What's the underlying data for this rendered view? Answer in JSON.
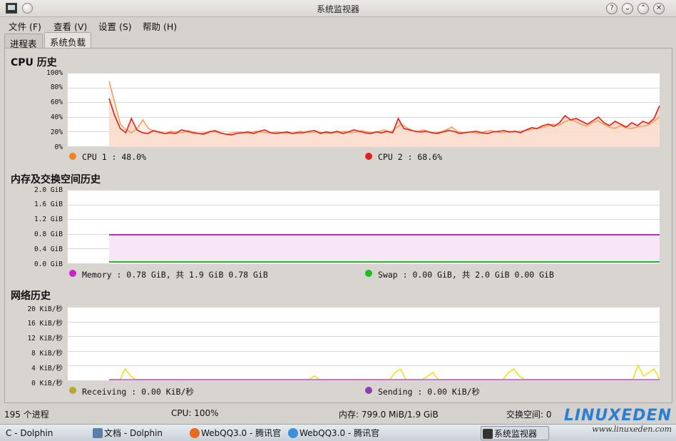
{
  "window": {
    "title": "系统监视器"
  },
  "menu": {
    "items": [
      "文件 (F)",
      "查看 (V)",
      "设置 (S)",
      "帮助 (H)"
    ]
  },
  "tabs": [
    {
      "label": "进程表",
      "active": false
    },
    {
      "label": "系统负载",
      "active": true
    }
  ],
  "sections": {
    "cpu": {
      "title": "CPU 历史",
      "ticks": [
        "100%",
        "80%",
        "60%",
        "40%",
        "20%",
        "0%"
      ],
      "legend": [
        {
          "label": "CPU 1 : 48.0%",
          "color": "#f58220"
        },
        {
          "label": "CPU 2 : 68.6%",
          "color": "#e0201c"
        }
      ]
    },
    "memory": {
      "title": "内存及交换空间历史",
      "ticks": [
        "2.0 GiB",
        "1.6 GiB",
        "1.2 GiB",
        "0.8 GiB",
        "0.4 GiB",
        "0.0 GiB"
      ],
      "legend": [
        {
          "label": "Memory : 0.78 GiB, 共 1.9 GiB 0.78 GiB",
          "color": "#cc22cc"
        },
        {
          "label": "Swap : 0.00 GiB, 共 2.0 GiB 0.00 GiB",
          "color": "#22bb22"
        }
      ]
    },
    "network": {
      "title": "网络历史",
      "ticks": [
        "20 KiB/秒",
        "16 KiB/秒",
        "12 KiB/秒",
        "8 KiB/秒",
        "4 KiB/秒",
        "0 KiB/秒"
      ],
      "legend": [
        {
          "label": "Receiving : 0.00 KiB/秒",
          "color": "#b8a830"
        },
        {
          "label": "Sending : 0.00 KiB/秒",
          "color": "#8844aa"
        }
      ]
    }
  },
  "chart_data": [
    {
      "type": "line",
      "title": "CPU 历史",
      "ylim": [
        0,
        100
      ],
      "ticks": [
        "100%",
        "80%",
        "60%",
        "40%",
        "20%",
        "0%"
      ],
      "grid": true,
      "x_count": 96,
      "series": [
        {
          "name": "CPU 1",
          "color": "#f5a060",
          "values": [
            90,
            60,
            30,
            22,
            18,
            24,
            36,
            24,
            20,
            18,
            17,
            20,
            19,
            18,
            21,
            19,
            17,
            18,
            20,
            19,
            17,
            16,
            18,
            19,
            18,
            17,
            20,
            19,
            18,
            18,
            19,
            18,
            17,
            18,
            20,
            19,
            18,
            19,
            18,
            17,
            18,
            19,
            20,
            18,
            19,
            21,
            19,
            18,
            20,
            22,
            18,
            24,
            30,
            25,
            21,
            20,
            22,
            19,
            18,
            19,
            22,
            26,
            20,
            18,
            19,
            18,
            17,
            20,
            21,
            19,
            18,
            20,
            19,
            20,
            21,
            22,
            24,
            25,
            27,
            30,
            28,
            33,
            36,
            34,
            30,
            27,
            32,
            35,
            30,
            26,
            24,
            28,
            25,
            24,
            26,
            27,
            29,
            34,
            40
          ]
        },
        {
          "name": "CPU 2",
          "color": "#e0201c",
          "values": [
            66,
            42,
            24,
            18,
            38,
            22,
            18,
            17,
            21,
            19,
            17,
            18,
            17,
            22,
            20,
            18,
            17,
            16,
            19,
            21,
            18,
            16,
            15,
            17,
            18,
            19,
            17,
            20,
            22,
            18,
            17,
            18,
            19,
            17,
            18,
            18,
            20,
            21,
            17,
            19,
            18,
            20,
            17,
            19,
            22,
            20,
            18,
            17,
            19,
            18,
            20,
            18,
            38,
            24,
            22,
            20,
            19,
            20,
            18,
            17,
            19,
            21,
            20,
            17,
            18,
            19,
            20,
            18,
            17,
            19,
            20,
            21,
            19,
            20,
            18,
            22,
            25,
            24,
            28,
            30,
            27,
            32,
            42,
            36,
            38,
            34,
            30,
            35,
            40,
            32,
            28,
            34,
            30,
            26,
            32,
            28,
            34,
            31,
            38,
            56
          ]
        }
      ]
    },
    {
      "type": "line",
      "title": "内存及交换空间历史",
      "ylim": [
        0,
        2.0
      ],
      "ticks": [
        "2.0 GiB",
        "1.6 GiB",
        "1.2 GiB",
        "0.8 GiB",
        "0.4 GiB",
        "0.0 GiB"
      ],
      "grid": true,
      "x_count": 96,
      "start_index": 7,
      "series": [
        {
          "name": "Memory",
          "color": "#cc22cc",
          "constant": 0.78
        },
        {
          "name": "Swap",
          "color": "#22bb22",
          "constant": 0.02
        }
      ]
    },
    {
      "type": "line",
      "title": "网络历史",
      "ylim": [
        0,
        20
      ],
      "ticks": [
        "20 KiB/秒",
        "16 KiB/秒",
        "12 KiB/秒",
        "8 KiB/秒",
        "4 KiB/秒",
        "0 KiB/秒"
      ],
      "grid": true,
      "x_count": 96,
      "series": [
        {
          "name": "Receiving",
          "color": "#f0e020",
          "values": [
            0,
            0,
            0,
            3,
            1,
            0,
            0,
            0,
            0,
            0,
            0,
            0,
            0,
            0,
            0,
            0,
            0,
            0,
            0,
            0,
            0,
            0,
            0,
            0,
            0,
            0,
            0,
            0,
            0,
            0,
            0,
            0,
            0,
            0,
            0,
            0,
            0,
            0,
            1,
            0,
            0,
            0,
            0,
            0,
            0,
            0,
            0,
            0,
            0,
            0,
            0,
            0,
            0,
            2,
            3,
            0,
            0,
            0,
            0,
            1,
            2,
            0,
            0,
            0,
            0,
            0,
            0,
            0,
            0,
            0,
            0,
            0,
            0,
            0,
            2,
            3,
            1,
            0,
            0,
            0,
            0,
            0,
            0,
            0,
            0,
            0,
            0,
            0,
            0,
            0,
            0,
            0,
            0,
            0,
            0,
            0,
            0,
            0,
            4,
            1,
            2,
            3,
            0
          ]
        },
        {
          "name": "Sending",
          "color": "#aa55cc",
          "values": [
            0,
            0,
            0,
            0,
            0,
            0,
            0,
            0,
            0,
            0,
            0,
            0,
            0,
            0,
            0,
            0,
            0,
            0,
            0,
            0,
            0,
            0,
            0,
            0,
            0,
            0,
            0,
            0,
            0,
            0,
            0,
            0,
            0,
            0,
            0,
            0,
            0,
            0,
            0,
            0,
            0,
            0,
            0,
            0,
            0,
            0,
            0,
            0,
            0,
            0,
            0,
            0,
            0,
            0,
            0,
            0,
            0,
            0,
            0,
            0,
            0,
            0,
            0,
            0,
            0,
            0,
            0,
            0,
            0,
            0,
            0,
            0,
            0,
            0,
            0,
            0,
            0,
            0,
            0,
            0,
            0,
            0,
            0,
            0,
            0,
            0,
            0,
            0,
            0,
            0,
            0,
            0,
            0,
            0,
            0,
            0,
            0,
            0,
            0,
            0,
            0,
            0,
            0
          ]
        }
      ]
    }
  ],
  "statusbar": {
    "processes": "195 个进程",
    "cpu": "CPU: 100%",
    "memory": "内存: 799.0 MiB/1.9 GiB",
    "swap": "交换空间: 0"
  },
  "taskbar": {
    "items": [
      {
        "label": "C - Dolphin",
        "icon_color": "#5a7fa8",
        "active": false
      },
      {
        "label": "文档 - Dolphin",
        "icon_color": "#5a7fa8",
        "active": false
      },
      {
        "label": "WebQQ3.0 - 腾讯官",
        "icon_color": "#e86a1c",
        "active": false
      },
      {
        "label": "WebQQ3.0 - 腾讯官",
        "icon_color": "#3d8fd8",
        "active": false
      },
      {
        "label": "系统监视器",
        "icon_color": "#333333",
        "active": true
      }
    ]
  },
  "watermark": {
    "logo": "LINUXEDEN",
    "url": "www.linuxeden.com"
  }
}
